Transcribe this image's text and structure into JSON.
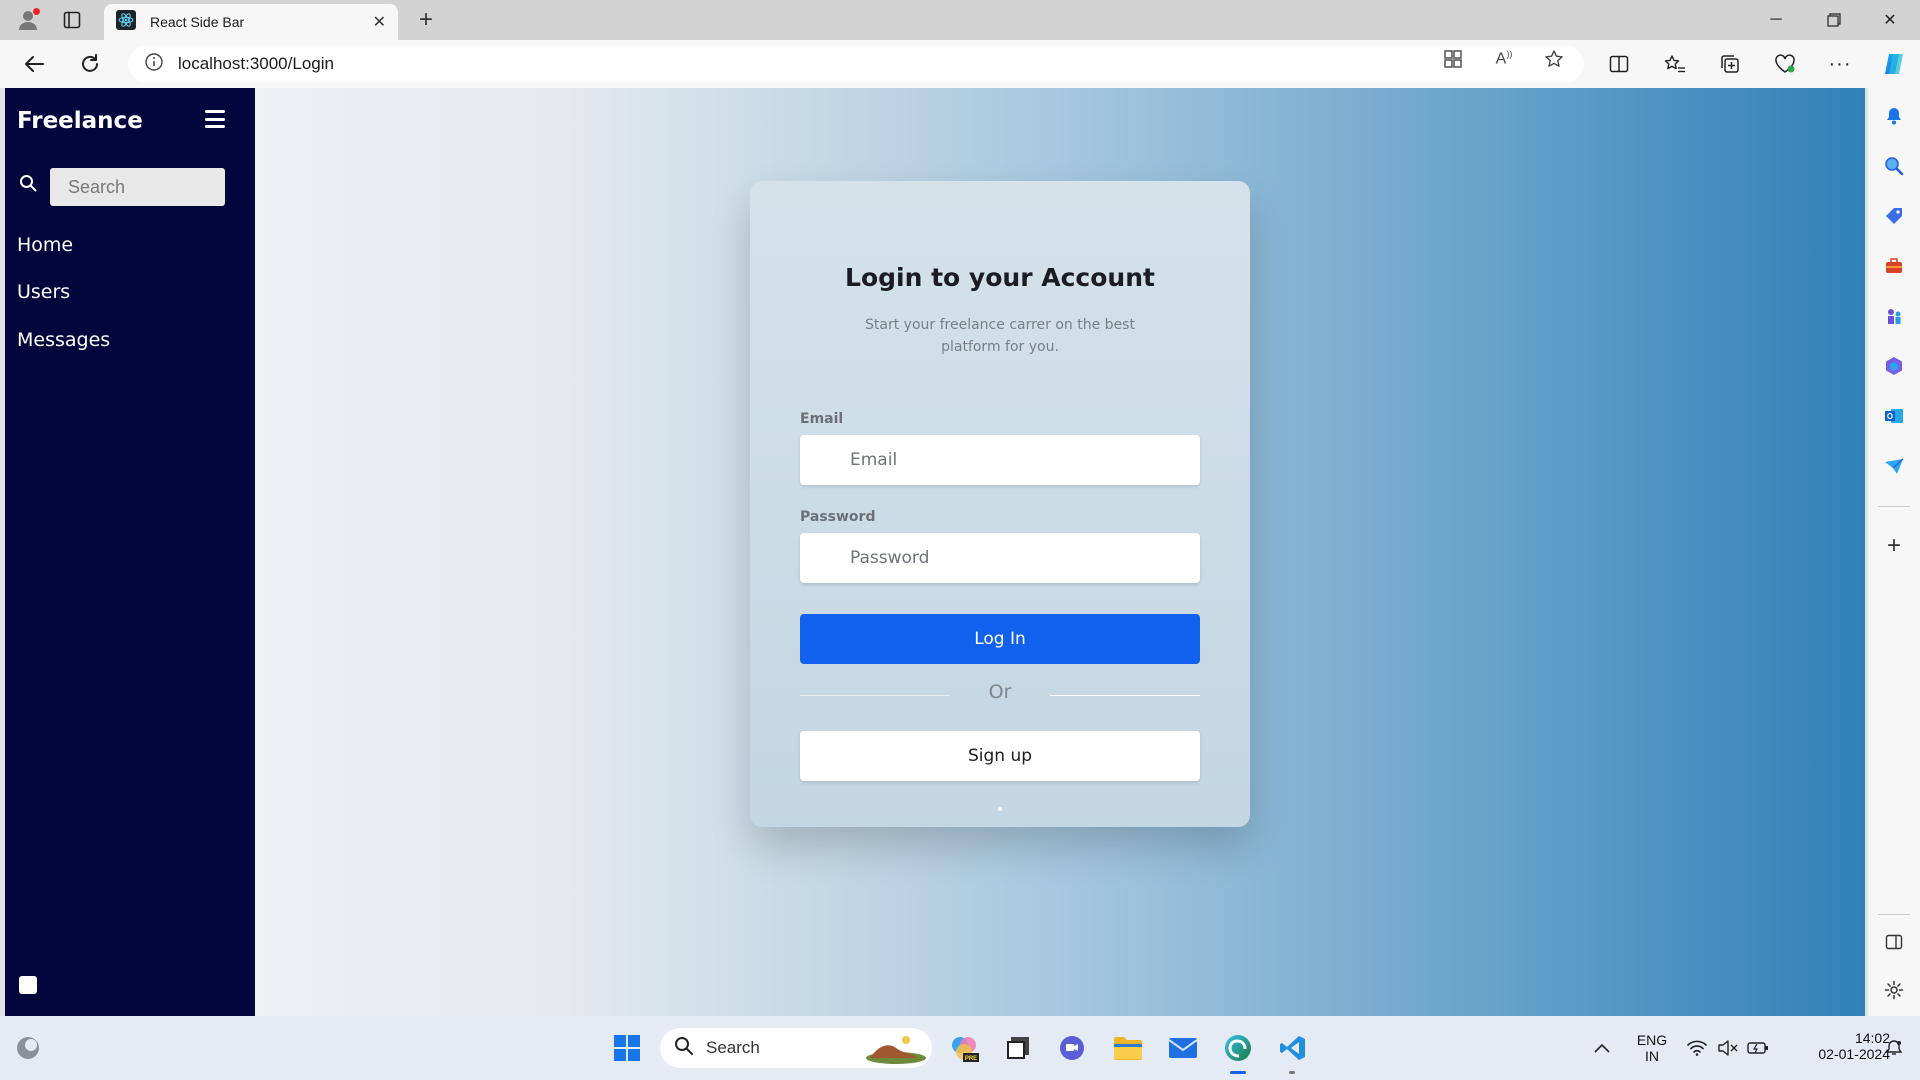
{
  "browser": {
    "tab_title": "React Side Bar",
    "url": "localhost:3000/Login"
  },
  "app": {
    "brand": "Freelance",
    "search_placeholder": "Search",
    "nav": [
      "Home",
      "Users",
      "Messages"
    ]
  },
  "login": {
    "title": "Login to your Account",
    "subtitle": "Start your freelance carrer on the best platform for you.",
    "email_label": "Email",
    "email_placeholder": "Email",
    "password_label": "Password",
    "password_placeholder": "Password",
    "login_button": "Log In",
    "or_text": "Or",
    "signup_button": "Sign up"
  },
  "taskbar": {
    "search_label": "Search",
    "language": "ENG",
    "region": "IN",
    "time": "14:02",
    "date": "02-01-2024"
  },
  "colors": {
    "sidebar_bg": "#02063d",
    "primary_button": "#1161ee",
    "gradient_end": "#2f81b8"
  }
}
